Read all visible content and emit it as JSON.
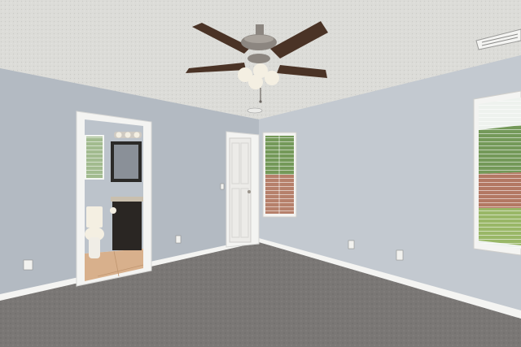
{
  "scene": {
    "colors": {
      "ceiling": "#dcdcd8",
      "wall_left": "#b3bac2",
      "wall_back": "#bcc3cb",
      "wall_right": "#c3c9d0",
      "carpet": "#7a7775",
      "trim": "#f4f4f2",
      "bath_floor": "#d8b08c",
      "vanity": "#2a2623",
      "fan_blade": "#4a3326",
      "fan_metal": "#8c8680",
      "light_glass": "#f4efe2",
      "window_light": "#eef2ee",
      "greenery": "#5e8a3e",
      "fence": "#a8634a",
      "lawn": "#8fb058"
    },
    "icons": [
      "ceiling-fan-icon",
      "light-fixture-icon",
      "outlet-icon",
      "air-vent-icon",
      "toilet-icon"
    ]
  }
}
